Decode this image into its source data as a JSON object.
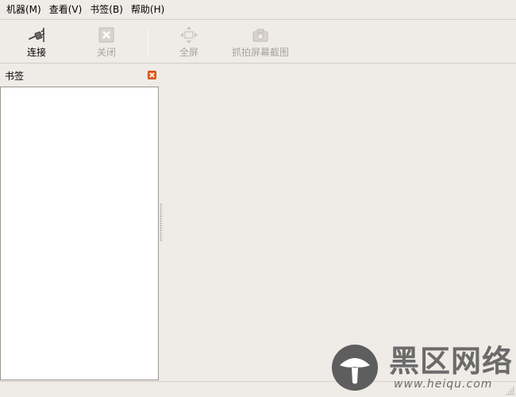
{
  "menubar": {
    "items": [
      {
        "label": "机器(M)"
      },
      {
        "label": "查看(V)"
      },
      {
        "label": "书签(B)"
      },
      {
        "label": "帮助(H)"
      }
    ]
  },
  "toolbar": {
    "connect": {
      "label": "连接",
      "icon": "plug-icon",
      "enabled": true
    },
    "close": {
      "label": "关闭",
      "icon": "close-x-icon",
      "enabled": false
    },
    "fullscreen": {
      "label": "全屏",
      "icon": "fullscreen-arrows-icon",
      "enabled": false
    },
    "screenshot": {
      "label": "抓拍屏幕截图",
      "icon": "camera-icon",
      "enabled": false
    }
  },
  "sidebar": {
    "title": "书签",
    "close_icon": "close-icon"
  },
  "watermark": {
    "title": "黑区网络",
    "url": "www.heiqu.com"
  },
  "colors": {
    "window_bg": "#efebe7",
    "list_bg": "#ffffff",
    "disabled_text": "#a8a39e",
    "close_accent": "#e8621e"
  }
}
